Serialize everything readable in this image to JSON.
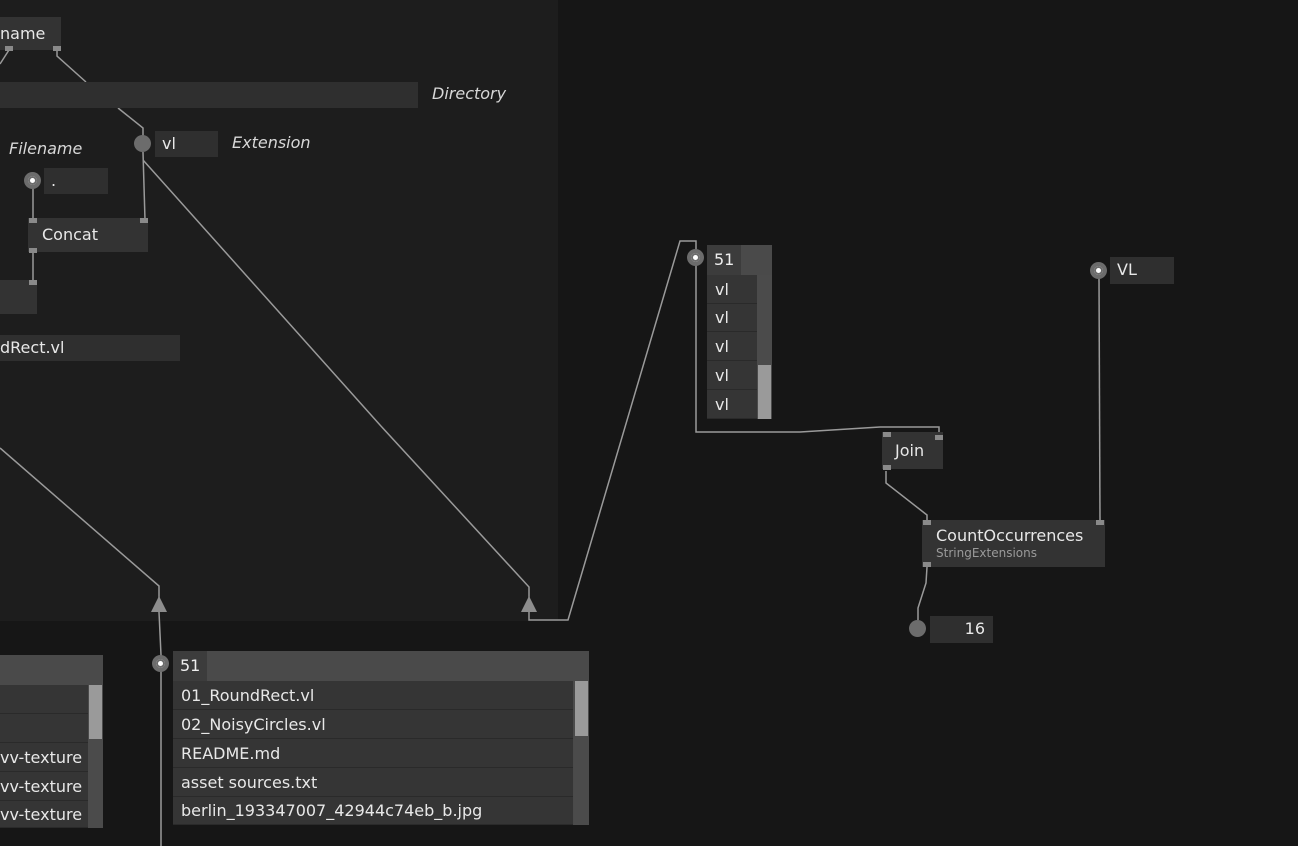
{
  "patch": {
    "nodes": {
      "name_node": "name",
      "concat": "Concat",
      "join": "Join",
      "count_occurrences": "CountOccurrences",
      "count_occurrences_category": "StringExtensions"
    },
    "labels": {
      "directory": "Directory",
      "extension": "Extension",
      "filename": "Filename"
    },
    "ioboxes": {
      "extension_value": "vl",
      "separator_value": ".",
      "filename_value": "dRect.vl",
      "search_value": "VL",
      "result_value": "16"
    },
    "extension_list": {
      "count": "51",
      "items": [
        "vl",
        "vl",
        "vl",
        "vl",
        "vl"
      ]
    },
    "file_list": {
      "count": "51",
      "items": [
        "01_RoundRect.vl",
        "02_NoisyCircles.vl",
        "README.md",
        "asset sources.txt",
        "berlin_193347007_42944c74eb_b.jpg"
      ]
    },
    "left_list": {
      "items": [
        "",
        "",
        "vv-texture",
        "vv-texture",
        "vv-texture"
      ]
    }
  },
  "colors": {
    "background": "#161616",
    "region": "#1d1d1d",
    "node": "#333333",
    "wire": "#9a9a9a"
  }
}
